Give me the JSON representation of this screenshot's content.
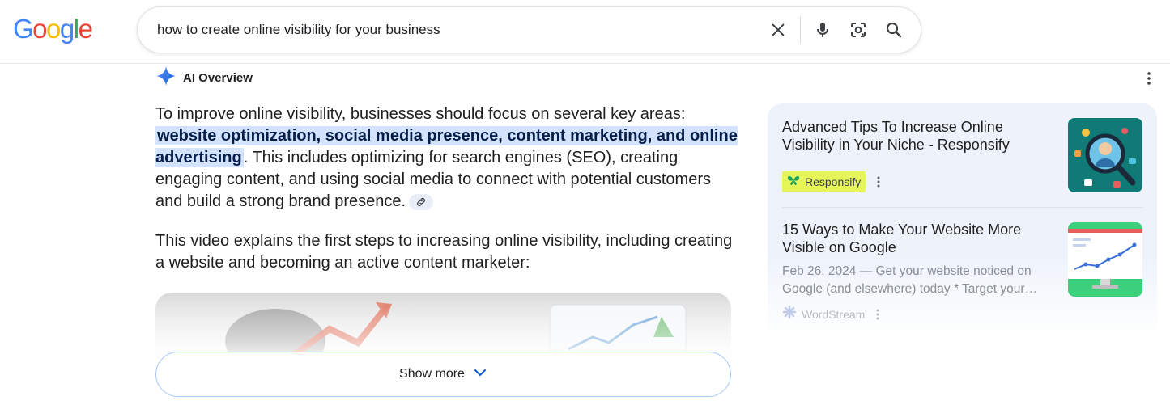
{
  "search": {
    "query": "how to create online visibility for your business"
  },
  "ai_overview": {
    "header_label": "AI Overview",
    "paragraph1_before": "To improve online visibility, businesses should focus on several key areas: ",
    "paragraph1_highlight": "website optimization, social media presence, content marketing, and online advertising",
    "paragraph1_after": ". This includes optimizing for search engines (SEO), creating engaging content, and using social media to connect with potential customers and build a strong brand presence.",
    "paragraph2": "This video explains the first steps to increasing online visibility, including creating a website and becoming an active content marketer:",
    "show_more_label": "Show more"
  },
  "sources": [
    {
      "title": "Advanced Tips To Increase Online Visibility in Your Niche - Responsify",
      "source_name": "Responsify"
    },
    {
      "title": "15 Ways to Make Your Website More Visible on Google",
      "snippet_line1": "Feb 26, 2024 — Get your website noticed on",
      "snippet_line2": "Google (and elsewhere) today * Target your…",
      "source_name": "WordStream"
    }
  ],
  "colors": {
    "highlight_bg": "#d3e3fd",
    "side_panel_bg": "#eef3fb",
    "source_badge_bg": "#e6f55a",
    "show_more_border": "#a8c7fa"
  },
  "icons": {
    "logo": "google-logo",
    "clear": "close-icon",
    "voice": "microphone-icon",
    "lens": "camera-lens-icon",
    "search": "search-icon",
    "ai": "sparkle-icon",
    "more": "more-vertical-icon",
    "link": "link-icon",
    "expand": "chevron-down-icon"
  }
}
